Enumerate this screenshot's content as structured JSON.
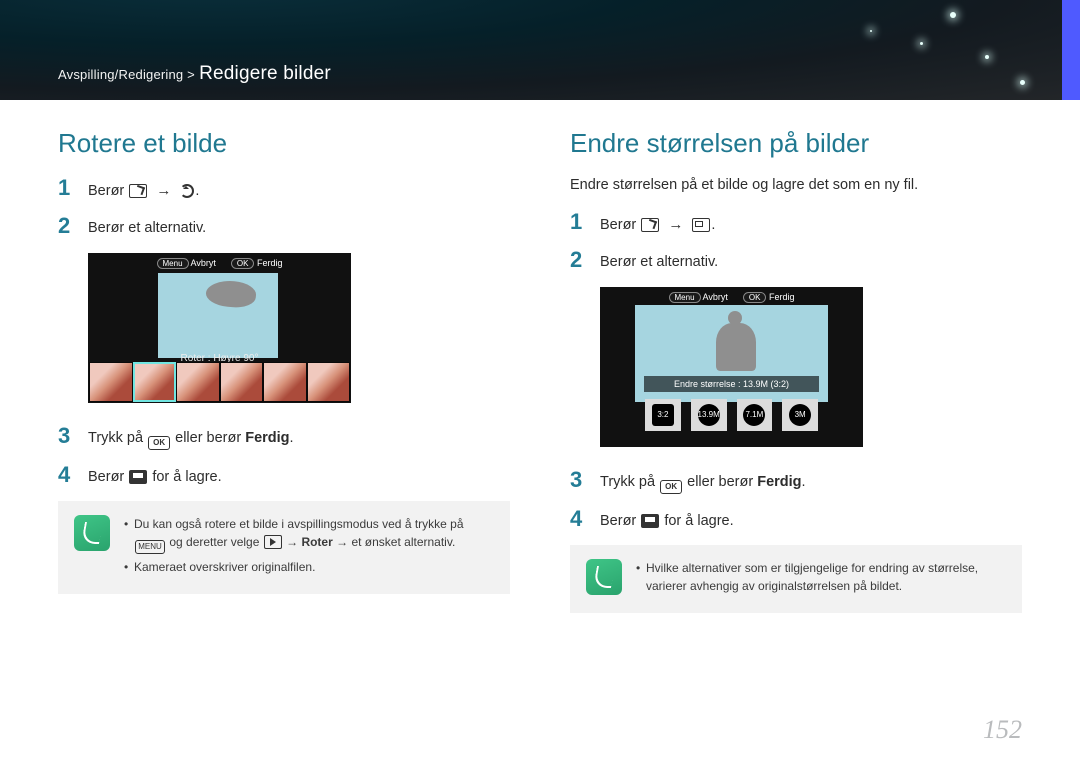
{
  "breadcrumb": {
    "section": "Avspilling/Redigering >",
    "page": "Redigere bilder"
  },
  "left": {
    "title": "Rotere et bilde",
    "step1_pre": "Berør ",
    "step2": "Berør et alternativ.",
    "shot": {
      "menu_btn": "Menu",
      "cancel": "Avbryt",
      "ok_btn": "OK",
      "done": "Ferdig",
      "label": "Roter : Høyre 90°"
    },
    "step3_pre": "Trykk på ",
    "step3_mid": " eller berør ",
    "step3_bold": "Ferdig",
    "step3_post": ".",
    "step4_pre": "Berør ",
    "step4_post": " for å lagre.",
    "note1a": "Du kan også rotere et bilde i avspillingsmodus ved å trykke på ",
    "note1b": " og deretter velge ",
    "note1c": " → ",
    "note1_bold": "Roter",
    "note1d": " → et ønsket alternativ.",
    "note2": "Kameraet overskriver originalfilen."
  },
  "right": {
    "title": "Endre størrelsen på bilder",
    "intro": "Endre størrelsen på et bilde og lagre det som en ny fil.",
    "step1_pre": "Berør ",
    "step2": "Berør et alternativ.",
    "shot": {
      "menu_btn": "Menu",
      "cancel": "Avbryt",
      "ok_btn": "OK",
      "done": "Ferdig",
      "label": "Endre størrelse : 13.9M (3:2)",
      "opt1": "3:2",
      "opt2": "13.9M",
      "opt3": "7.1M",
      "opt4": "3M"
    },
    "step3_pre": "Trykk på ",
    "step3_mid": " eller berør ",
    "step3_bold": "Ferdig",
    "step3_post": ".",
    "step4_pre": "Berør ",
    "step4_post": " for å lagre.",
    "note": "Hvilke alternativer som er tilgjengelige for endring av størrelse, varierer avhengig av originalstørrelsen på bildet."
  },
  "pagenum": "152",
  "ok_label": "OK",
  "menu_label": "MENU"
}
